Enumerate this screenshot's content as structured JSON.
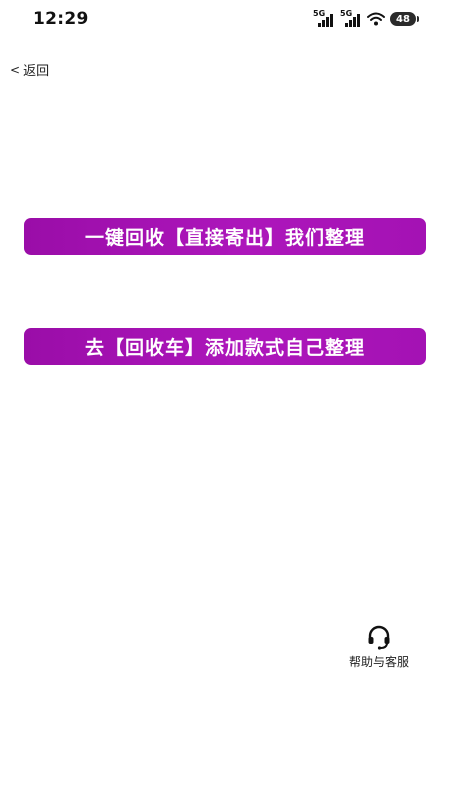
{
  "status_bar": {
    "time": "12:29",
    "signal1_tag": "5G",
    "signal2_tag": "5G",
    "battery": "48"
  },
  "nav": {
    "back_chevron": "<",
    "back_label": "返回"
  },
  "actions": {
    "one_key_recycle_label": "一键回收【直接寄出】我们整理",
    "recycle_cart_label": "去【回收车】添加款式自己整理"
  },
  "help": {
    "icon": "headset-icon",
    "label": "帮助与客服"
  },
  "colors": {
    "button_gradient_start": "#9a0da8",
    "button_gradient_end": "#a412b4",
    "button_text": "#ffffff"
  }
}
